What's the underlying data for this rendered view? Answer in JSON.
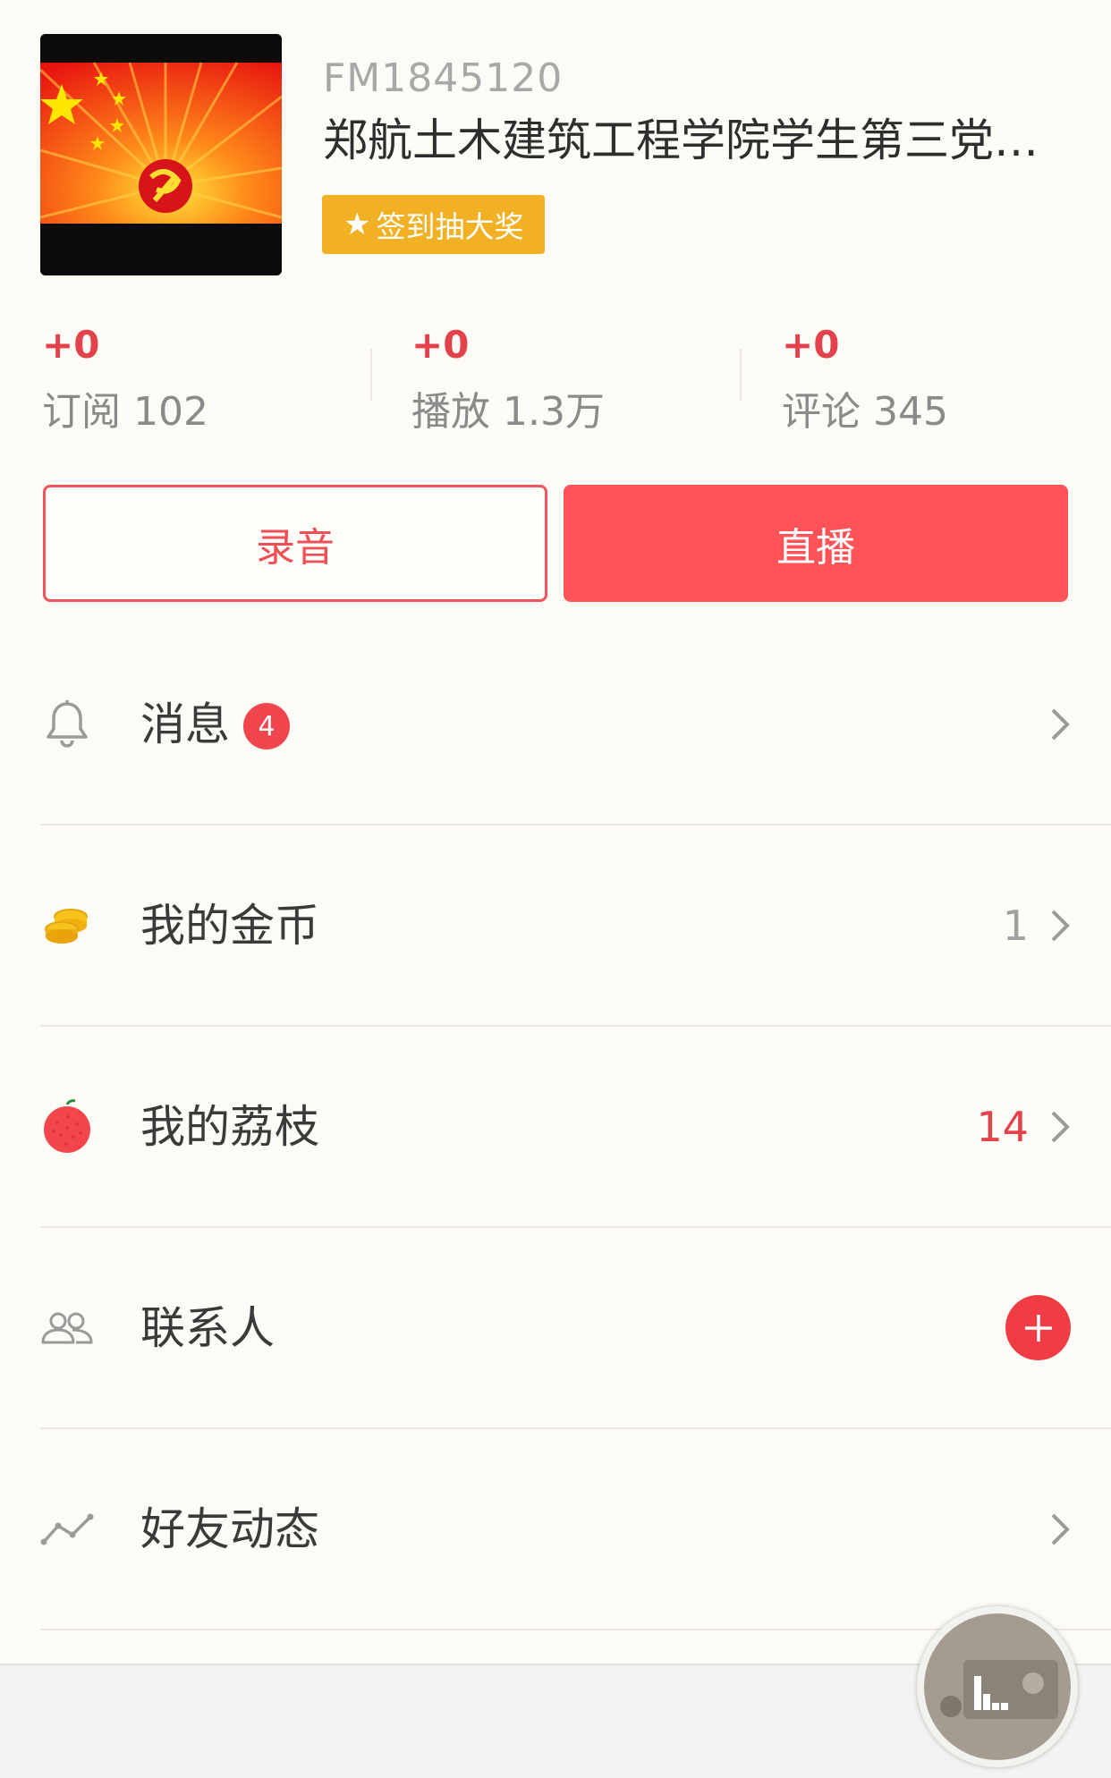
{
  "profile": {
    "fm_id": "FM1845120",
    "name": "郑航土木建筑工程学院学生第三党…",
    "checkin_label": "签到抽大奖"
  },
  "stats": [
    {
      "delta": "+0",
      "label": "订阅",
      "value": "102"
    },
    {
      "delta": "+0",
      "label": "播放",
      "value": "1.3万"
    },
    {
      "delta": "+0",
      "label": "评论",
      "value": "345"
    }
  ],
  "actions": {
    "record_label": "录音",
    "live_label": "直播"
  },
  "menu": {
    "items": [
      {
        "label": "消息",
        "icon": "bell-icon",
        "badge": "4",
        "value": ""
      },
      {
        "label": "我的金币",
        "icon": "coins-icon",
        "value": "1"
      },
      {
        "label": "我的荔枝",
        "icon": "lychee-icon",
        "value": "14"
      },
      {
        "label": "联系人",
        "icon": "contacts-icon",
        "value": ""
      },
      {
        "label": "好友动态",
        "icon": "activity-icon",
        "value": ""
      }
    ]
  },
  "colors": {
    "accent": "#ff5358",
    "badge": "#f0454d",
    "gold": "#f2b024",
    "background": "#fdfbf5"
  }
}
